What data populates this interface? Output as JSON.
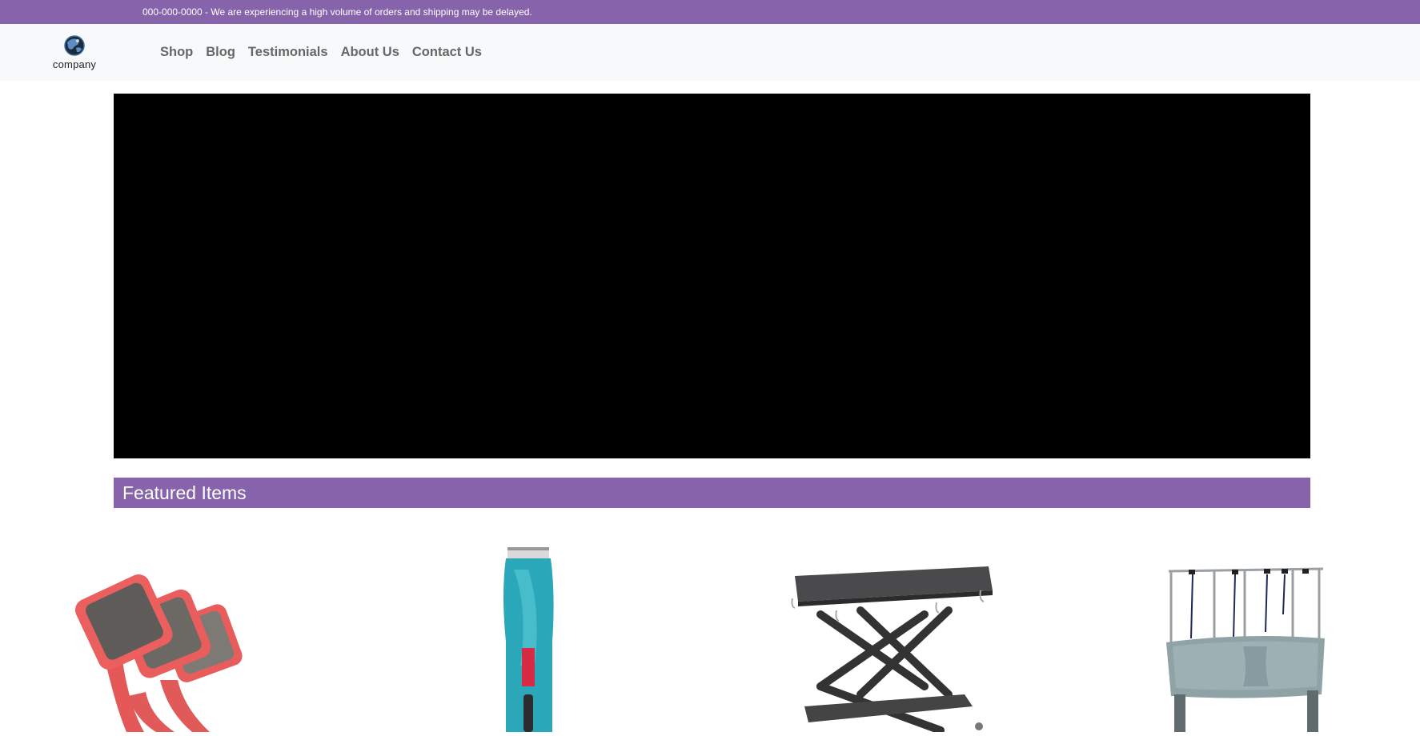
{
  "topbar": {
    "notice": "000-000-0000 - We are experiencing a high volume of orders and shipping may be delayed."
  },
  "brand": {
    "logo_text": "company"
  },
  "nav": {
    "items": [
      {
        "label": "Shop"
      },
      {
        "label": "Blog"
      },
      {
        "label": "Testimonials"
      },
      {
        "label": "About Us"
      },
      {
        "label": "Contact Us"
      }
    ]
  },
  "featured": {
    "heading": "Featured Items"
  },
  "products": [
    {
      "icon": "slicker-brushes-image"
    },
    {
      "icon": "clipper-image"
    },
    {
      "icon": "grooming-table-image"
    },
    {
      "icon": "grooming-tub-image"
    }
  ],
  "colors": {
    "accent": "#8663aa",
    "nav_bg": "#f8f9fa",
    "hero_bg": "#000000"
  }
}
